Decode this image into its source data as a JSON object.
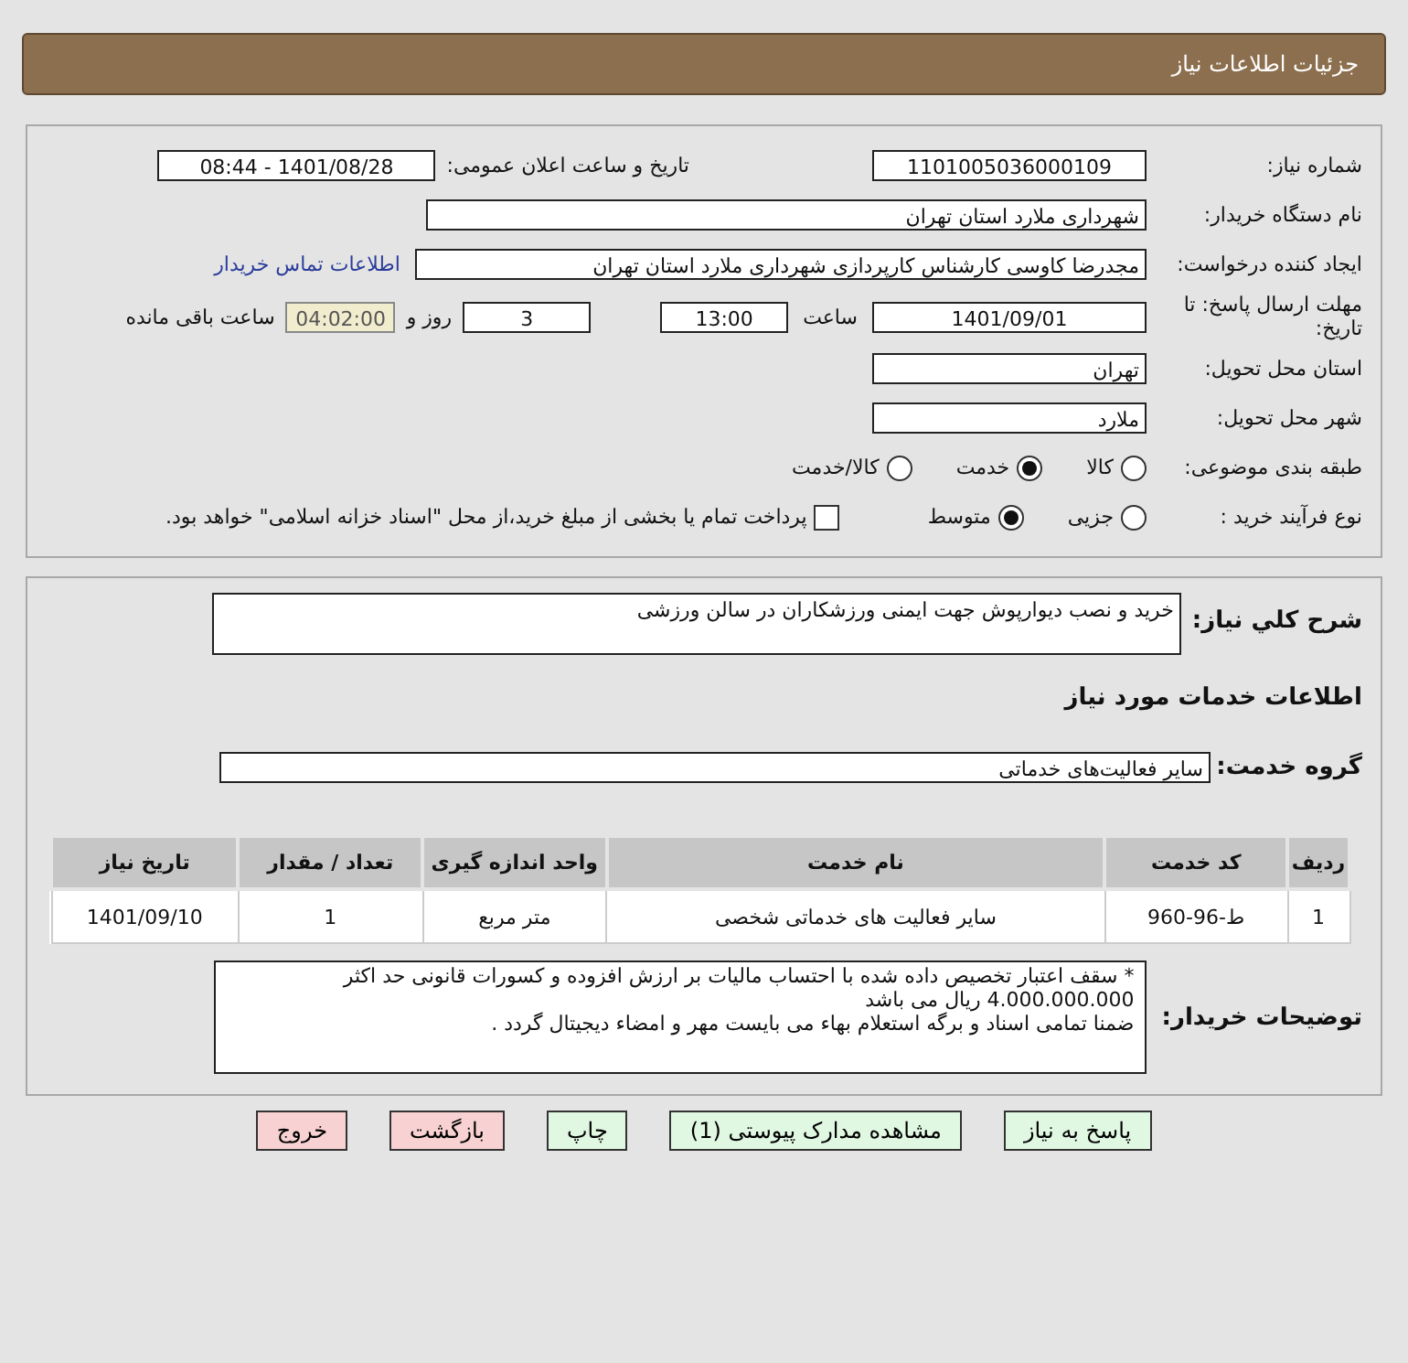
{
  "title": "جزئیات اطلاعات نیاز",
  "need_number": {
    "label": "شماره نیاز:",
    "value": "1101005036000109"
  },
  "announce": {
    "label": "تاریخ و ساعت اعلان عمومی:",
    "value": "1401/08/28 - 08:44"
  },
  "buyer_org": {
    "label": "نام دستگاه خریدار:",
    "value": "شهرداری ملارد استان تهران"
  },
  "requester": {
    "label": "ایجاد کننده درخواست:",
    "value": "مجدرضا کاوسی کارشناس کارپردازی شهرداری ملارد استان تهران",
    "link": "اطلاعات تماس خریدار"
  },
  "deadline": {
    "label": "مهلت ارسال پاسخ: تا تاریخ:",
    "date": "1401/09/01",
    "time_label": "ساعت",
    "time": "13:00",
    "days": "3",
    "days_label": "روز و",
    "remaining": "04:02:00",
    "remaining_label": "ساعت باقی مانده"
  },
  "province": {
    "label": "استان محل تحویل:",
    "value": "تهران"
  },
  "city": {
    "label": "شهر محل تحویل:",
    "value": "ملارد"
  },
  "category": {
    "label": "طبقه بندی موضوعی:",
    "options": [
      {
        "label": "کالا",
        "selected": false
      },
      {
        "label": "خدمت",
        "selected": true
      },
      {
        "label": "کالا/خدمت",
        "selected": false
      }
    ]
  },
  "process": {
    "label": "نوع فرآیند خرید :",
    "options": [
      {
        "label": "جزیی",
        "selected": false
      },
      {
        "label": "متوسط",
        "selected": true
      }
    ],
    "payment": {
      "label": "پرداخت تمام یا بخشی از مبلغ خرید،از محل \"اسناد خزانه اسلامی\" خواهد بود.",
      "checked": false
    }
  },
  "summary": {
    "label": "شرح کلي نياز:",
    "value": "خرید و نصب دیوارپوش جهت ایمنی ورزشکاران در سالن ورزشی"
  },
  "services_heading": "اطلاعات خدمات مورد نیاز",
  "service_group": {
    "label": "گروه خدمت:",
    "value": "سایر فعالیت‌های خدماتی"
  },
  "table": {
    "columns": [
      "ردیف",
      "کد خدمت",
      "نام خدمت",
      "واحد اندازه گیری",
      "تعداد / مقدار",
      "تاریخ نیاز"
    ],
    "rows": [
      [
        "1",
        "ط-96-960",
        "سایر فعالیت های خدماتی شخصی",
        "متر مربع",
        "1",
        "1401/09/10"
      ]
    ]
  },
  "notes": {
    "label": "توضیحات خریدار:",
    "paragraphs": [
      "* سقف اعتبار تخصیص داده شده با احتساب مالیات بر ارزش افزوده و کسورات قانونی حد اکثر 4.000.000.000 ریال می باشد",
      "ضمنا تمامی اسناد و برگه استعلام بهاء می بایست مهر و امضاء دیجیتال گردد ."
    ]
  },
  "buttons": [
    {
      "label": "پاسخ به نیاز",
      "kind": "action"
    },
    {
      "label": "مشاهده مدارک پیوستی (1)",
      "kind": "action"
    },
    {
      "label": "چاپ",
      "kind": "action"
    },
    {
      "label": "بازگشت",
      "kind": "exit"
    },
    {
      "label": "خروج",
      "kind": "exit"
    }
  ]
}
